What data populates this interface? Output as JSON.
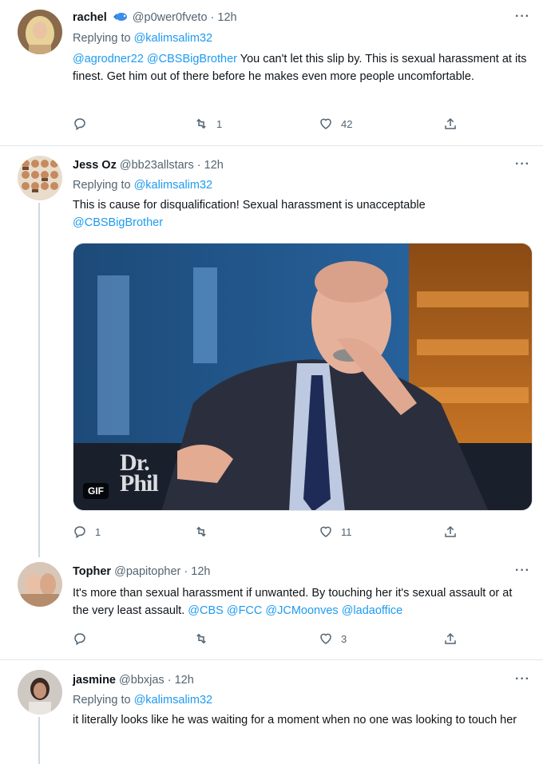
{
  "tweets": [
    {
      "name": "rachel",
      "handle": "@p0wer0fveto",
      "time": "12h",
      "reply_prefix": "Replying to",
      "reply_to": "@kalimsalim32",
      "mention1": "@agrodner22",
      "mention2": "@CBSBigBrother",
      "text": "You can't let this slip by. This is sexual harassment at its finest. Get him out of there before he makes even more people uncomfortable.",
      "reply_count": "",
      "retweet_count": "1",
      "like_count": "42"
    },
    {
      "name": "Jess Oz",
      "handle": "@bb23allstars",
      "time": "12h",
      "reply_prefix": "Replying to",
      "reply_to": "@kalimsalim32",
      "text": "This is cause for disqualification! Sexual harassment is unacceptable",
      "mention": "@CBSBigBrother",
      "media_badge": "GIF",
      "media_logo_line1": "Dr.",
      "media_logo_line2": "Phil",
      "reply_count": "1",
      "retweet_count": "",
      "like_count": "11"
    },
    {
      "name": "Topher",
      "handle": "@papitopher",
      "time": "12h",
      "text": "It's more than sexual harassment if unwanted. By touching her it's sexual assault or at the very least assault.",
      "mentions": "@CBS @FCC @JCMoonves @ladaoffice",
      "reply_count": "",
      "retweet_count": "",
      "like_count": "3"
    },
    {
      "name": "jasmine",
      "handle": "@bbxjas",
      "time": "12h",
      "reply_prefix": "Replying to",
      "reply_to": "@kalimsalim32",
      "text": "it literally looks like he was waiting for a moment when no one was looking to touch her"
    }
  ],
  "colors": {
    "link": "#1d9bf0",
    "muted": "#536471",
    "text": "#0f1419",
    "divider": "#e1e6ea"
  }
}
